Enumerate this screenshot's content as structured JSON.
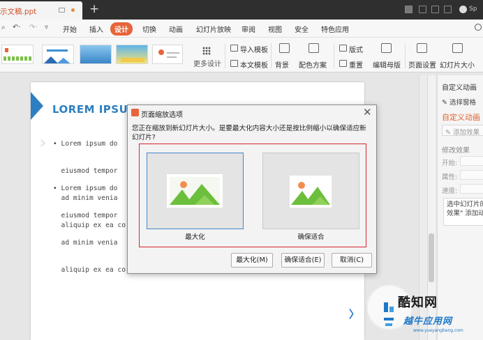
{
  "titlebar": {
    "doc_name": "示文稿.ppt",
    "new_tab": "+",
    "user_name": "Sp"
  },
  "menu": {
    "items": [
      "开始",
      "插入",
      "设计",
      "切换",
      "动画",
      "幻灯片放映",
      "审阅",
      "视图",
      "安全",
      "特色应用"
    ],
    "active": "设计"
  },
  "ribbon": {
    "more_designs": "更多设计",
    "import_template": "导入模板",
    "text_template": "本文模板",
    "background": "背景",
    "color_scheme": "配色方案",
    "layout": "版式",
    "reset": "重置",
    "edit_master": "编辑母版",
    "page_setup": "页面设置",
    "slide_size": "幻灯片大小"
  },
  "slide": {
    "title": "LOREM IPSUM DOLOR",
    "bullets": [
      [
        "• Lorem ipsum do",
        "  eiusmod tempor",
        "  ad minim venia",
        "  aliquip ex ea co"
      ],
      [
        "• Lorem ipsum do",
        "  eiusmod tempor",
        "  ad minim venia",
        "  aliquip ex ea co"
      ]
    ]
  },
  "pane": {
    "custom_animation_dropdown": "自定义动画",
    "select_pane": "选择窗格",
    "heading": "自定义动画",
    "add_effect": "添加效果",
    "modify_effect": "修改效果",
    "start_label": "开始:",
    "property_label": "属性:",
    "speed_label": "速度:",
    "hint_lines": [
      "选中幻灯片的",
      "效果\" 添加动"
    ]
  },
  "dialog": {
    "title": "页面缩放选项",
    "message": "您正在缩放到新幻灯片大小。是要最大化内容大小还是按比例缩小以确保适应新幻灯片?",
    "options": [
      {
        "label": "最大化",
        "selected": true
      },
      {
        "label": "确保适合",
        "selected": false
      }
    ],
    "buttons": {
      "maximize": "最大化(M)",
      "ensure_fit": "确保适合(E)",
      "cancel": "取消(C)"
    },
    "frame_color": "#d9232e",
    "selected_color": "#3f87c9"
  },
  "watermark": {
    "logo_text": "酷知网",
    "logo_text2": "越牛应用网",
    "url": "www.yueyangbang.com"
  },
  "colors": {
    "accent": "#e8643a",
    "slide_title": "#2d7fc1",
    "mountain_green": "#6cbf3c",
    "sun": "#f28d52"
  }
}
